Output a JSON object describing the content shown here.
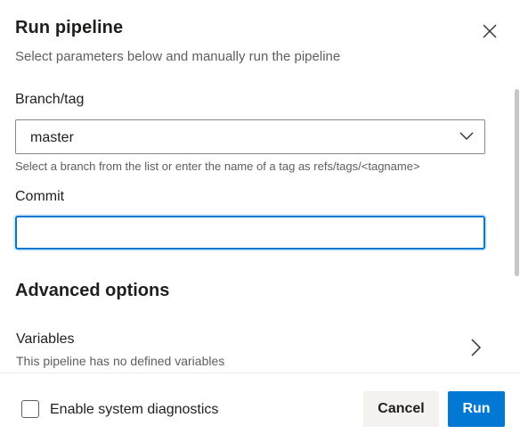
{
  "dialog": {
    "title": "Run pipeline",
    "subtitle": "Select parameters below and manually run the pipeline",
    "close_icon": "close-icon"
  },
  "branch": {
    "label": "Branch/tag",
    "value": "master",
    "hint": "Select a branch from the list or enter the name of a tag as refs/tags/<tagname>",
    "chevron_icon": "chevron-down-icon"
  },
  "commit": {
    "label": "Commit",
    "value": ""
  },
  "advanced": {
    "title": "Advanced options",
    "variables": {
      "title": "Variables",
      "description": "This pipeline has no defined variables",
      "chevron_icon": "chevron-right-icon"
    }
  },
  "footer": {
    "diagnostics_label": "Enable system diagnostics",
    "diagnostics_checked": false,
    "cancel_label": "Cancel",
    "run_label": "Run"
  },
  "colors": {
    "accent": "#0078d4",
    "secondary_button": "#f3f2f1",
    "text_primary": "#201f1e",
    "text_secondary": "#605e5c"
  }
}
